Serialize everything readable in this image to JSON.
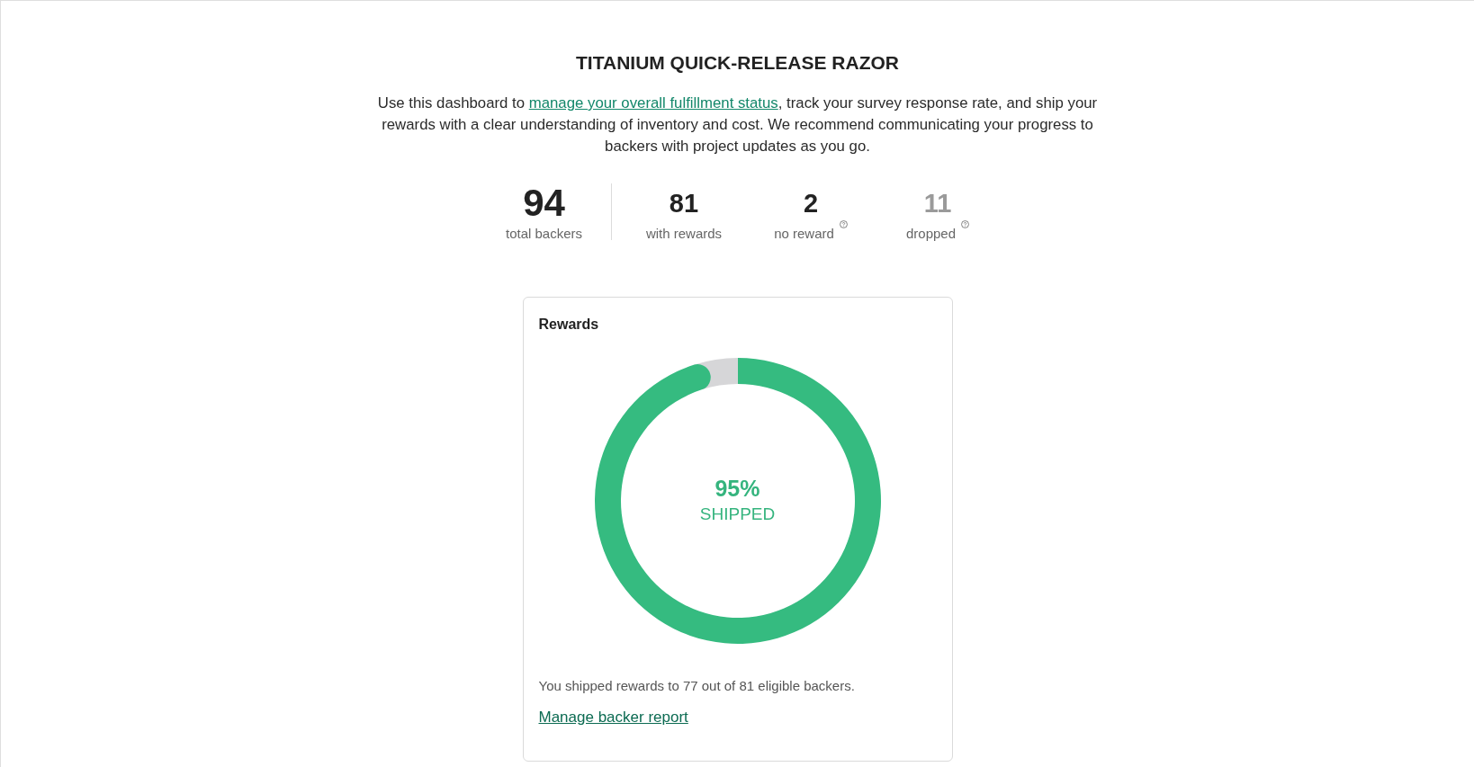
{
  "title": "TITANIUM QUICK-RELEASE RAZOR",
  "intro": {
    "before": "Use this dashboard to ",
    "link": "manage your overall fulfillment status",
    "after": ", track your survey response rate, and ship your rewards with a clear understanding of inventory and cost. We recommend communicating your progress to backers with project updates as you go."
  },
  "stats": [
    {
      "kind": "total",
      "value": "94",
      "label": "total backers",
      "help": false
    },
    {
      "kind": "count",
      "value": "81",
      "label": "with rewards",
      "help": false
    },
    {
      "kind": "count",
      "value": "2",
      "label": "no reward",
      "help": true
    },
    {
      "kind": "muted",
      "value": "11",
      "label": "dropped",
      "help": true
    }
  ],
  "card": {
    "title": "Rewards",
    "chart_data": {
      "type": "donut",
      "values": [
        95,
        5
      ]
    },
    "center_value": "95%",
    "center_label": "SHIPPED",
    "summary": "You shipped rewards to 77 out of 81 eligible backers.",
    "link": "Manage backer report"
  }
}
